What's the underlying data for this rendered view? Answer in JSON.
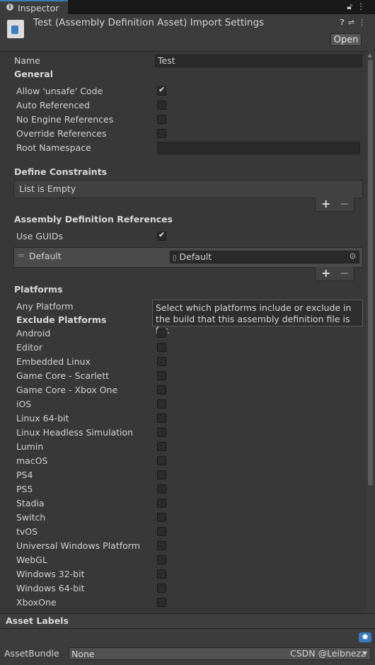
{
  "tab": {
    "label": "Inspector",
    "info_icon": "info-icon",
    "lock_icon": "lock-icon",
    "menu_icon": "more-icon"
  },
  "header": {
    "title": "Test (Assembly Definition Asset) Import Settings",
    "icon": "assembly-definition-icon",
    "help_icon": "help-icon",
    "settings_icon": "settings-icon",
    "more_icon": "more-icon",
    "open_label": "Open"
  },
  "name_field": {
    "label": "Name",
    "value": "Test"
  },
  "general": {
    "title": "General",
    "allow_unsafe": {
      "label": "Allow 'unsafe' Code",
      "checked": true
    },
    "auto_referenced": {
      "label": "Auto Referenced",
      "checked": false
    },
    "no_engine_refs": {
      "label": "No Engine References",
      "checked": false
    },
    "override_refs": {
      "label": "Override References",
      "checked": false
    },
    "root_namespace": {
      "label": "Root Namespace",
      "value": ""
    }
  },
  "define_constraints": {
    "title": "Define Constraints",
    "empty_text": "List is Empty",
    "add": "+",
    "remove": "−"
  },
  "assembly_refs": {
    "title": "Assembly Definition References",
    "use_guids": {
      "label": "Use GUIDs",
      "checked": true
    },
    "items": [
      {
        "label": "Default",
        "value": "Default"
      }
    ],
    "add": "+",
    "remove": "−"
  },
  "platforms": {
    "title": "Platforms",
    "any_platform_label": "Any Platform",
    "exclude_title": "Exclude Platforms",
    "tooltip": "Select which platforms include or exclude in the build that this assembly definition file is for.",
    "list": [
      "Android",
      "Editor",
      "Embedded Linux",
      "Game Core - Scarlett",
      "Game Core - Xbox One",
      "iOS",
      "Linux 64-bit",
      "Linux Headless Simulation",
      "Lumin",
      "macOS",
      "PS4",
      "PS5",
      "Stadia",
      "Switch",
      "tvOS",
      "Universal Windows Platform",
      "WebGL",
      "Windows 32-bit",
      "Windows 64-bit",
      "XboxOne"
    ]
  },
  "asset_labels": {
    "title": "Asset Labels",
    "tag_icon": "tag-icon"
  },
  "asset_bundle": {
    "label": "AssetBundle",
    "value": "None"
  },
  "watermark": "CSDN @Leibnezz"
}
